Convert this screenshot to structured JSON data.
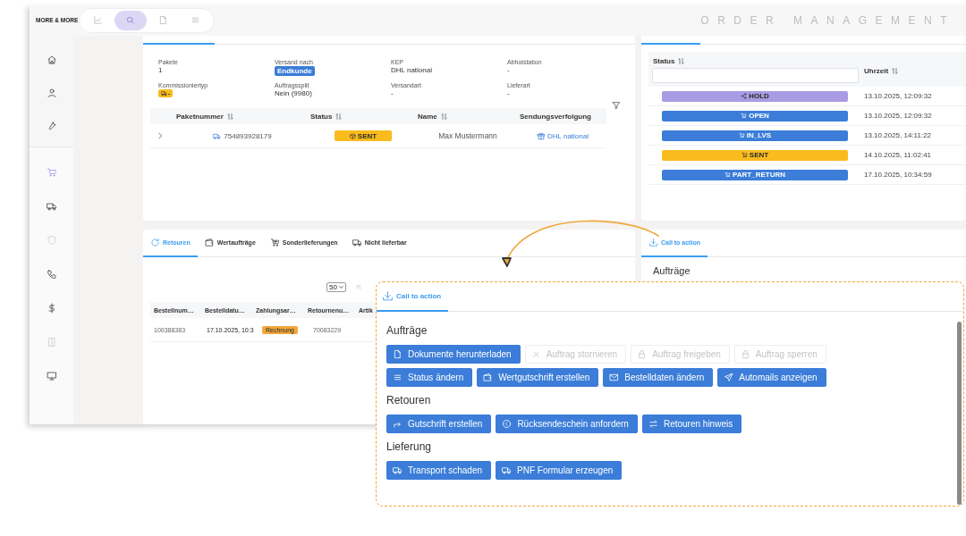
{
  "header": {
    "logo": "MORE & MORE",
    "nav": [
      {
        "selected": false
      },
      {
        "selected": true
      },
      {
        "selected": false
      },
      {
        "selected": false
      }
    ],
    "app_title": "ORDER MANAGEMENT"
  },
  "sidebar": {
    "top_items": [
      {
        "selected": false,
        "disabled": false
      },
      {
        "selected": false,
        "disabled": false
      },
      {
        "selected": false,
        "disabled": false
      }
    ],
    "items": [
      {
        "selected": true,
        "disabled": false
      },
      {
        "selected": false,
        "disabled": false
      },
      {
        "selected": false,
        "disabled": true
      },
      {
        "selected": false,
        "disabled": false
      },
      {
        "selected": false,
        "disabled": false
      },
      {
        "selected": false,
        "disabled": true
      },
      {
        "selected": false,
        "disabled": false
      }
    ]
  },
  "shipment": {
    "fields": [
      {
        "label": "Pakete",
        "value": "1",
        "kind": "text"
      },
      {
        "label": "Versand nach",
        "value": "Endkunde",
        "kind": "badge",
        "color": "#3b7dd8"
      },
      {
        "label": "KEP",
        "value": "DHL national",
        "kind": "text"
      },
      {
        "label": "Abholstation",
        "value": "-",
        "kind": "text"
      },
      {
        "label": "Kommissioniertyp",
        "value": "-",
        "kind": "icon_badge",
        "color": "#f9bb1e"
      },
      {
        "label": "Auftragssplit",
        "value": "Nein (9980)",
        "kind": "text"
      },
      {
        "label": "Versandart",
        "value": "-",
        "kind": "text"
      },
      {
        "label": "Lieferart",
        "value": "-",
        "kind": "text"
      }
    ],
    "packages": {
      "columns": [
        "Paketnummer",
        "Status",
        "Name",
        "Sendungsverfolgung"
      ],
      "rows": [
        {
          "expanded": false,
          "number": "754893928179",
          "status": "SENT",
          "color": "#f9bb1e",
          "name": "Max Mustermann",
          "tracking": "DHL national"
        }
      ]
    }
  },
  "status_history": {
    "columns": [
      "Status",
      "Uhrzeit"
    ],
    "rows": [
      {
        "status": "HOLD",
        "kind": "hold",
        "color": "#a99be3",
        "time": "13.10.2025, 12:09:32"
      },
      {
        "status": "OPEN",
        "kind": "order",
        "color": "#3b7dd8",
        "time": "13.10.2025, 12:09:32"
      },
      {
        "status": "IN_LVS",
        "kind": "order",
        "color": "#3b7dd8",
        "time": "13.10.2025, 14:11:22"
      },
      {
        "status": "SENT",
        "kind": "order",
        "color": "#f9bb1e",
        "time": "14.10.2025, 11:02:41"
      },
      {
        "status": "PART_RETURN",
        "kind": "order",
        "color": "#3b7dd8",
        "time": "17.10.2025, 10:34:59"
      }
    ]
  },
  "returns": {
    "tabs": [
      {
        "label": "Retouren",
        "selected": true
      },
      {
        "label": "Wertaufträge",
        "selected": false
      },
      {
        "label": "Sonderlieferungen",
        "selected": false
      },
      {
        "label": "Nicht lieferbar",
        "selected": false
      }
    ],
    "page_size": "50",
    "columns": [
      "Bestellnum…",
      "Bestelldatu…",
      "Zahlungsar…",
      "Retournenu…",
      "Artik"
    ],
    "rows": [
      {
        "order": "100388383",
        "date": "17.10.2025, 10:3",
        "payment": "Rechnung",
        "color": "#f0a73c",
        "return_no": "70083229"
      }
    ]
  },
  "actions_panel": {
    "tab": {
      "label": "Call to action",
      "selected": true
    },
    "heading": "Aufträge"
  },
  "callout": {
    "tab": {
      "label": "Call to action",
      "selected": true
    },
    "groups": [
      {
        "title": "Aufträge",
        "buttons": [
          {
            "label": "Dokumente herunterladen",
            "disabled": false
          },
          {
            "label": "Auftrag stornieren",
            "disabled": true
          },
          {
            "label": "Auftrag freigeben",
            "disabled": true
          },
          {
            "label": "Auftrag sperren",
            "disabled": true
          },
          {
            "label": "Status ändern",
            "disabled": false
          },
          {
            "label": "Wertgutschrift erstellen",
            "disabled": false
          },
          {
            "label": "Bestelldaten ändern",
            "disabled": false
          },
          {
            "label": "Automails anzeigen",
            "disabled": false
          }
        ]
      },
      {
        "title": "Retouren",
        "buttons": [
          {
            "label": "Gutschrift erstellen",
            "disabled": false
          },
          {
            "label": "Rücksendeschein anfordern",
            "disabled": false
          },
          {
            "label": "Retouren hinweis",
            "disabled": false
          }
        ]
      },
      {
        "title": "Lieferung",
        "buttons": [
          {
            "label": "Transport schaden",
            "disabled": false
          },
          {
            "label": "PNF Formular erzeugen",
            "disabled": false
          }
        ]
      }
    ]
  }
}
